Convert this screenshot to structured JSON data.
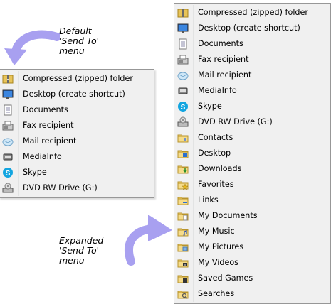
{
  "callouts": {
    "default": [
      "Default",
      "'Send To'",
      "menu"
    ],
    "expanded": [
      "Expanded",
      "'Send To'",
      "menu"
    ]
  },
  "colors": {
    "arrow": "#a8a0f0",
    "menu_bg": "#f0f0f0",
    "menu_border": "#979797"
  },
  "default_menu": {
    "items": [
      {
        "label": "Compressed (zipped) folder",
        "icon": "zip-folder-icon"
      },
      {
        "label": "Desktop (create shortcut)",
        "icon": "desktop-icon"
      },
      {
        "label": "Documents",
        "icon": "documents-icon"
      },
      {
        "label": "Fax recipient",
        "icon": "fax-icon"
      },
      {
        "label": "Mail recipient",
        "icon": "mail-icon"
      },
      {
        "label": "MediaInfo",
        "icon": "mediainfo-icon"
      },
      {
        "label": "Skype",
        "icon": "skype-icon"
      },
      {
        "label": "DVD RW Drive (G:)",
        "icon": "dvd-drive-icon"
      }
    ]
  },
  "expanded_menu": {
    "items": [
      {
        "label": "Compressed (zipped) folder",
        "icon": "zip-folder-icon"
      },
      {
        "label": "Desktop (create shortcut)",
        "icon": "desktop-icon"
      },
      {
        "label": "Documents",
        "icon": "documents-icon"
      },
      {
        "label": "Fax recipient",
        "icon": "fax-icon"
      },
      {
        "label": "Mail recipient",
        "icon": "mail-icon"
      },
      {
        "label": "MediaInfo",
        "icon": "mediainfo-icon"
      },
      {
        "label": "Skype",
        "icon": "skype-icon"
      },
      {
        "label": "DVD RW Drive (G:)",
        "icon": "dvd-drive-icon"
      },
      {
        "label": "Contacts",
        "icon": "contacts-folder-icon"
      },
      {
        "label": "Desktop",
        "icon": "desktop-folder-icon"
      },
      {
        "label": "Downloads",
        "icon": "downloads-folder-icon"
      },
      {
        "label": "Favorites",
        "icon": "favorites-folder-icon"
      },
      {
        "label": "Links",
        "icon": "links-folder-icon"
      },
      {
        "label": "My Documents",
        "icon": "my-documents-folder-icon"
      },
      {
        "label": "My Music",
        "icon": "my-music-folder-icon"
      },
      {
        "label": "My Pictures",
        "icon": "my-pictures-folder-icon"
      },
      {
        "label": "My Videos",
        "icon": "my-videos-folder-icon"
      },
      {
        "label": "Saved Games",
        "icon": "saved-games-folder-icon"
      },
      {
        "label": "Searches",
        "icon": "searches-folder-icon"
      }
    ]
  }
}
